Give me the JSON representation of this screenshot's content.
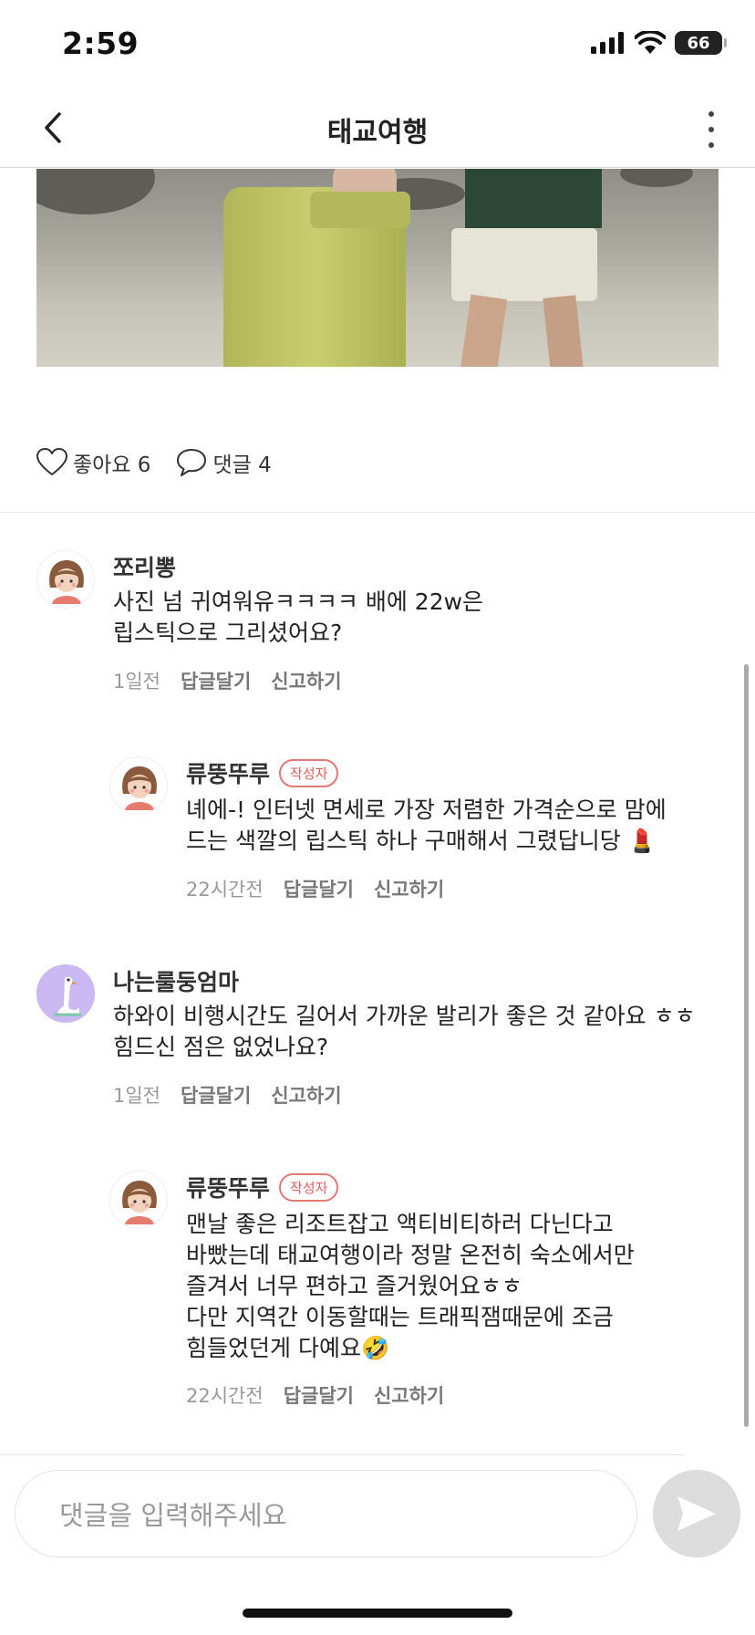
{
  "status_bar": {
    "time": "2:59",
    "battery": "66"
  },
  "header": {
    "title": "태교여행"
  },
  "reactions": {
    "like_label": "좋아요 6",
    "comment_label": "댓글 4"
  },
  "comments": [
    {
      "name": "쪼리뽕",
      "text": "사진 넘 귀여워유ㅋㅋㅋㅋ 배에 22w은\n립스틱으로 그리셨어요?",
      "time": "1일전",
      "reply": "답글달기",
      "report": "신고하기"
    },
    {
      "name": "류뚱뚜루",
      "badge": "작성자",
      "text": "녜에-! 인터넷 면세로 가장 저렴한 가격순으로 맘에\n드는 색깔의 립스틱 하나 구매해서 그렸답니당 💄",
      "time": "22시간전",
      "reply": "답글달기",
      "report": "신고하기"
    },
    {
      "name": "나는룰둥엄마",
      "text": "하와이 비행시간도 길어서 가까운 발리가 좋은 것 같아요 ㅎㅎ\n힘드신 점은 없었나요?",
      "time": "1일전",
      "reply": "답글달기",
      "report": "신고하기"
    },
    {
      "name": "류뚱뚜루",
      "badge": "작성자",
      "text": "맨날 좋은 리조트잡고 액티비티하러 다닌다고\n바빴는데 태교여행이라 정말 온전히 숙소에서만\n즐겨서 너무 편하고 즐거웠어요ㅎㅎ\n다만 지역간 이동할때는 트래픽잼때문에 조금\n힘들었던게 다예요🤣",
      "time": "22시간전",
      "reply": "답글달기",
      "report": "신고하기"
    }
  ],
  "input": {
    "placeholder": "댓글을 입력해주세요"
  },
  "icons": {
    "back": "chevron-left-icon",
    "more": "more-vertical-icon",
    "like": "heart-icon",
    "comment": "speech-bubble-icon",
    "send": "send-icon"
  },
  "colors": {
    "author_badge": "#e05f58",
    "send_button": "#dcdcdc"
  }
}
